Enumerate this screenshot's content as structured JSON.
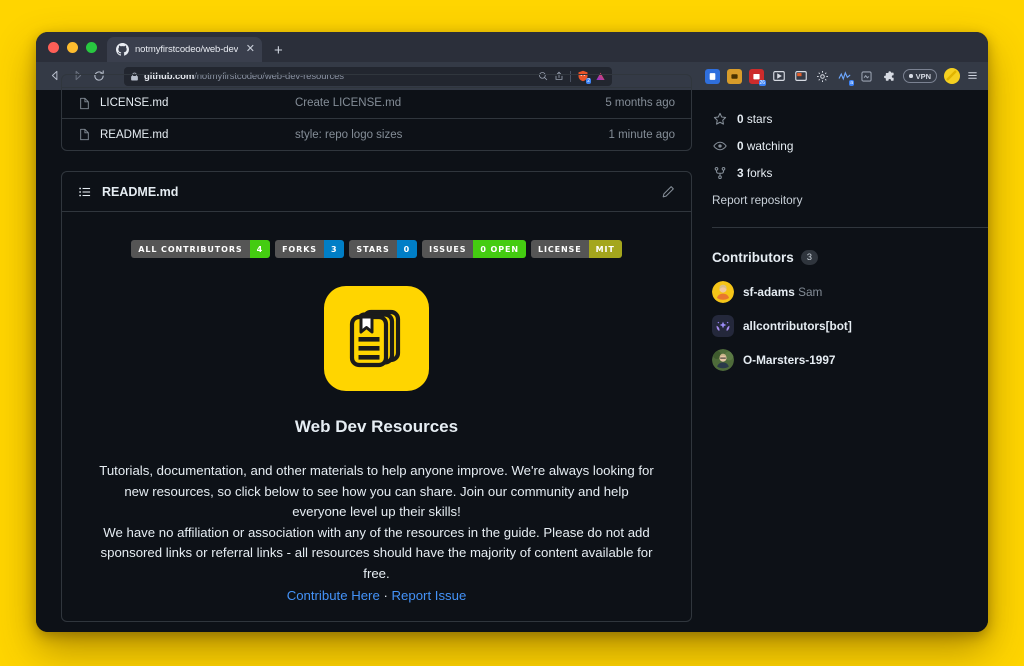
{
  "browser": {
    "tab": {
      "title": "notmyfirstcodeo/web-dev-reso",
      "favicon": "github-icon",
      "close": "✕"
    },
    "new_tab": "+",
    "nav": {
      "back": "back-icon",
      "forward": "forward-icon",
      "reload": "reload-icon"
    },
    "url": {
      "lock": "lock-icon",
      "domain": "github.com",
      "path": "/notmyfirstcodeo/web-dev-resources"
    },
    "url_actions": [
      {
        "name": "zoom-search-icon"
      },
      {
        "name": "share-icon"
      }
    ],
    "extensions": [
      {
        "name": "pocket-extension-icon",
        "color": "#2f6fdd",
        "badge": ""
      },
      {
        "name": "wallet-extension-icon",
        "color": "#d89c2a",
        "badge": ""
      },
      {
        "name": "calendar-extension-icon",
        "color": "#cc2b2b",
        "badge": "26"
      },
      {
        "name": "media-player-extension-icon",
        "color": "#d6dae2",
        "badge": ""
      },
      {
        "name": "notes-extension-icon",
        "color": "#d6dae2",
        "badge": ""
      },
      {
        "name": "settings-gear-extension-icon",
        "color": "#d6dae2",
        "badge": ""
      },
      {
        "name": "analytics-extension-icon",
        "color": "#6ea8ff",
        "badge": "a"
      },
      {
        "name": "screenshot-extension-icon",
        "color": "#9aa2b1",
        "badge": ""
      },
      {
        "name": "puzzle-extensions-icon",
        "color": "#d6dae2",
        "badge": ""
      }
    ],
    "vpn_label": "VPN",
    "menu": "hamburger-menu-icon",
    "adblock_badge": "2"
  },
  "files": {
    "rows": [
      {
        "icon": "file-icon",
        "name": "LICENSE.md",
        "message": "Create LICENSE.md",
        "time": "5 months ago"
      },
      {
        "icon": "file-icon",
        "name": "README.md",
        "message": "style: repo logo sizes",
        "time": "1 minute ago"
      }
    ]
  },
  "readme": {
    "header_title": "README.md",
    "list_icon": "list-unordered-icon",
    "edit_icon": "pencil-icon",
    "badges": [
      {
        "label": "ALL CONTRIBUTORS",
        "value": "4",
        "color": "#44cc11"
      },
      {
        "label": "FORKS",
        "value": "3",
        "color": "#007ec6"
      },
      {
        "label": "STARS",
        "value": "0",
        "color": "#007ec6"
      },
      {
        "label": "ISSUES",
        "value": "0 OPEN",
        "color": "#44cc11"
      },
      {
        "label": "LICENSE",
        "value": "MIT",
        "color": "#a4a61d"
      }
    ],
    "logo": {
      "name": "web-dev-resources-logo",
      "bg": "#FFD500",
      "fg": "#1b1b1b"
    },
    "project_title": "Web Dev Resources",
    "paragraphs": [
      "Tutorials, documentation, and other materials to help anyone improve. We're always looking for new resources, so click below to see how you can share. Join our community and help everyone level up their skills!",
      "We have no affiliation or association with any of the resources in the guide. Please do not add sponsored links or referral links - all resources should have the majority of content available for free."
    ],
    "links": [
      {
        "label": "Contribute Here"
      },
      {
        "label": "Report Issue"
      }
    ],
    "link_separator": "·"
  },
  "sidebar": {
    "stats": [
      {
        "icon": "star-icon",
        "count": "0",
        "label": "stars"
      },
      {
        "icon": "eye-icon",
        "count": "0",
        "label": "watching"
      },
      {
        "icon": "fork-icon",
        "count": "3",
        "label": "forks"
      }
    ],
    "report_repository": "Report repository",
    "contributors": {
      "title": "Contributors",
      "count": "3",
      "people": [
        {
          "avatar": "avatar-sf-adams",
          "username": "sf-adams",
          "realname": "Sam"
        },
        {
          "avatar": "avatar-allcontributors-bot",
          "username": "allcontributors[bot]",
          "realname": ""
        },
        {
          "avatar": "avatar-o-marsters-1997",
          "username": "O-Marsters-1997",
          "realname": ""
        }
      ]
    }
  }
}
